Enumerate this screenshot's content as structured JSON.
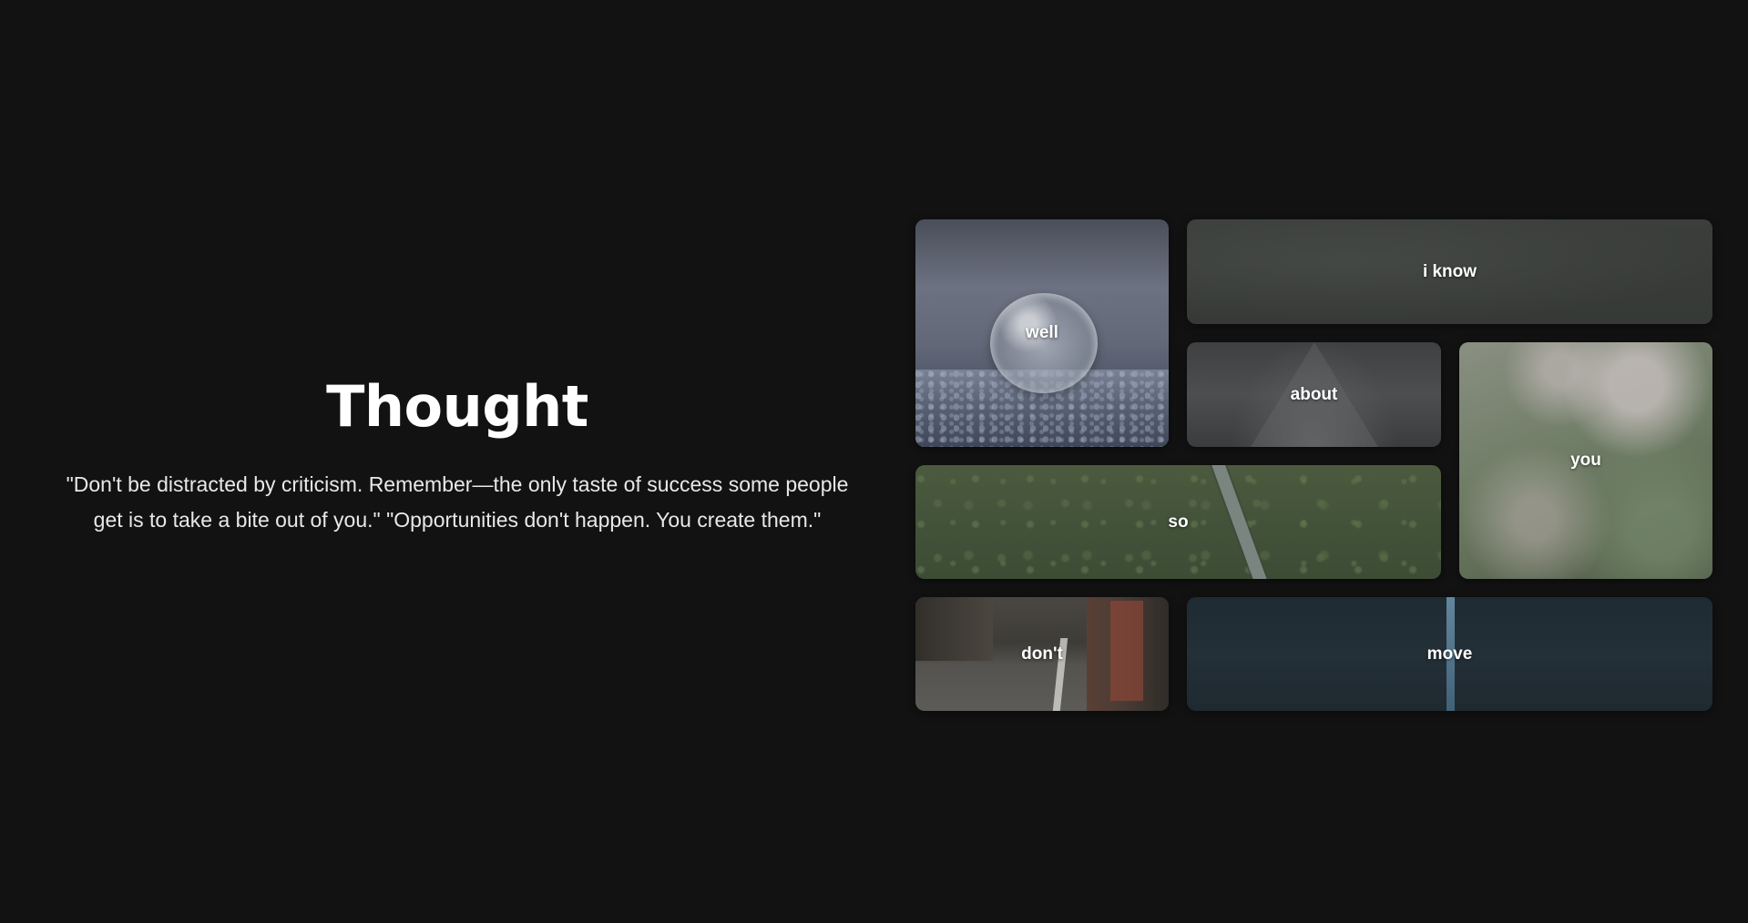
{
  "hero": {
    "title": "Thought",
    "quote": "\"Don't be distracted by criticism. Remember—the only taste of success some people get is to take a bite out of you.\" \"Opportunities don't happen. You create them.\""
  },
  "gallery": {
    "tiles": [
      {
        "label": "well",
        "image": "frozen-bubble-image"
      },
      {
        "label": "i know",
        "image": "dark-texture-image"
      },
      {
        "label": "about",
        "image": "misty-road-image"
      },
      {
        "label": "you",
        "image": "blossom-image"
      },
      {
        "label": "so",
        "image": "forest-road-aerial-image"
      },
      {
        "label": "don't",
        "image": "city-street-image"
      },
      {
        "label": "move",
        "image": "dark-water-image"
      }
    ]
  },
  "colors": {
    "background": "#121212",
    "text": "#ffffff",
    "quote_text": "#e8e8e8"
  }
}
